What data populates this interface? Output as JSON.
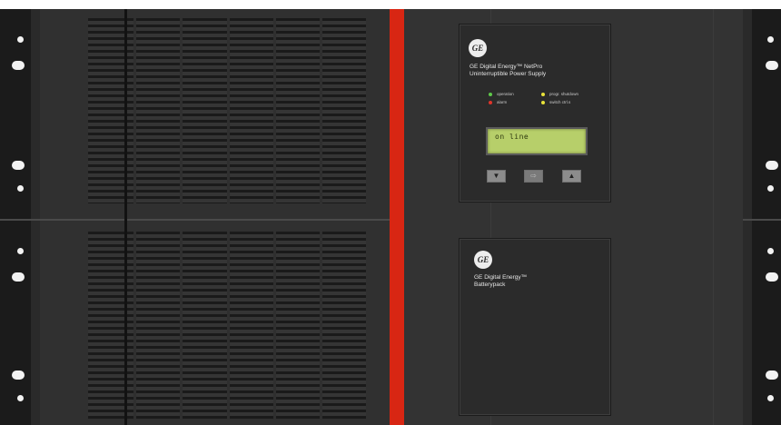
{
  "ups": {
    "brand_line1": "GE Digital Energy™ NetPro",
    "brand_line2": "Uninterruptible Power Supply",
    "logo_text": "GE",
    "indicators": [
      {
        "label": "operation",
        "color": "#5ec84a"
      },
      {
        "label": "alarm",
        "color": "#e0352b"
      },
      {
        "label": "progr. shutdown",
        "color": "#e8e23a"
      },
      {
        "label": "switch ctrl.s",
        "color": "#e8e23a"
      }
    ],
    "lcd_text": "on line",
    "buttons": {
      "down_icon": "arrow-down",
      "enter_icon": "enter-arrow",
      "up_icon": "arrow-up"
    }
  },
  "battery": {
    "logo_text": "GE",
    "brand_line1": "GE Digital Energy™",
    "brand_line2": "Batterypack"
  },
  "colors": {
    "chassis": "#2f2f2f",
    "accent_stripe": "#d82613",
    "lcd_background": "#b7cf6a"
  }
}
